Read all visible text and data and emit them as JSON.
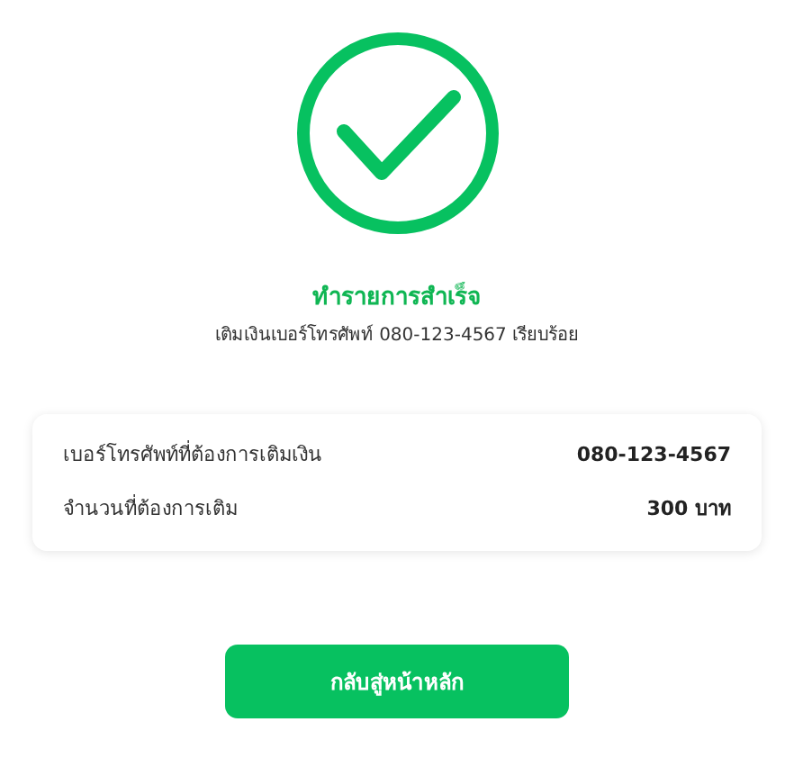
{
  "result": {
    "title": "ทำรายการสำเร็จ",
    "message": "เติมเงินเบอร์โทรศัพท์ 080-123-4567 เรียบร้อย"
  },
  "details": [
    {
      "label": "เบอร์โทรศัพท์ที่ต้องการเติมเงิน",
      "value": "080-123-4567"
    },
    {
      "label": "จำนวนที่ต้องการเติม",
      "value": "300 บาท"
    }
  ],
  "button": {
    "label": "กลับสู่หน้าหลัก"
  }
}
